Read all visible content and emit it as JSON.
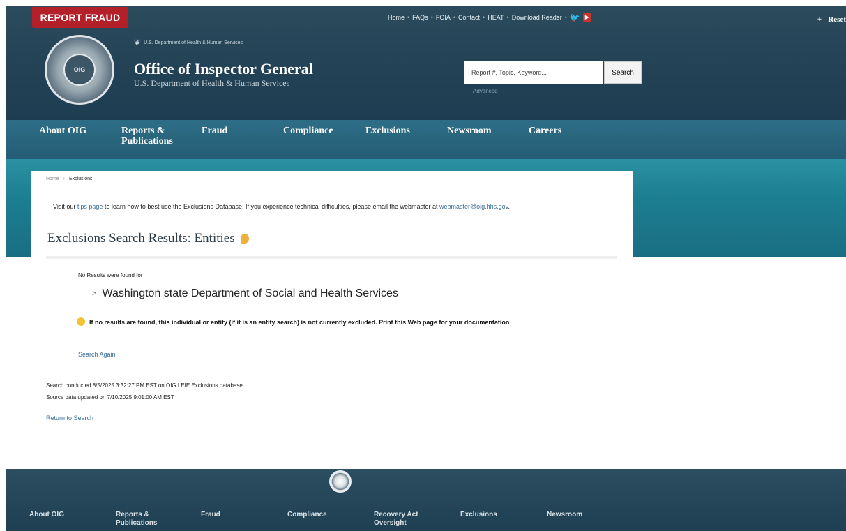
{
  "header": {
    "report_fraud": "REPORT FRAUD",
    "utility_links": [
      "Home",
      "FAQs",
      "FOIA",
      "Contact",
      "HEAT",
      "Download Reader"
    ],
    "resize_controls": "+ - Reset",
    "dept_small": "U.S. Department of Health & Human Services",
    "title": "Office of Inspector General",
    "subtitle": "U.S. Department of Health & Human Services",
    "seal_text": "OIG",
    "search": {
      "placeholder": "Report #, Topic, Keyword...",
      "button": "Search",
      "advanced": "Advanced"
    }
  },
  "nav": {
    "items": [
      {
        "label": "About OIG"
      },
      {
        "label": "Reports & Publications"
      },
      {
        "label": "Fraud"
      },
      {
        "label": "Compliance"
      },
      {
        "label": "Exclusions"
      },
      {
        "label": "Newsroom"
      },
      {
        "label": "Careers"
      }
    ]
  },
  "breadcrumb": {
    "home": "Home",
    "sep": "›",
    "current": "Exclusions"
  },
  "tip": {
    "before": "Visit our ",
    "link": "tips page",
    "middle": " to learn how to best use the Exclusions Database. If you experience technical difficulties, please email the webmaster at ",
    "email": "webmaster@oig.hhs.gov",
    "after": "."
  },
  "results": {
    "title": "Exclusions Search Results: Entities",
    "no_results": "No Results were found for",
    "query": "Washington state Department of Social and Health Services",
    "note": "If no results are found, this individual or entity (if it is an entity search) is not currently excluded. Print this Web page for your documentation",
    "search_again": "Search Again",
    "conducted": "Search conducted 8/5/2025 3:32:27 PM EST on OIG LEIE Exclusions database.",
    "updated": "Source data updated on 7/10/2025 9:01:00 AM EST",
    "return": "Return to Search"
  },
  "footer": {
    "items": [
      {
        "label": "About OIG"
      },
      {
        "label": "Reports & Publications"
      },
      {
        "label": "Fraud"
      },
      {
        "label": "Compliance"
      },
      {
        "label": "Recovery Act Oversight"
      },
      {
        "label": "Exclusions"
      },
      {
        "label": "Newsroom"
      }
    ]
  },
  "colors": {
    "report_fraud": "#b3202a",
    "header_bg": "#234255",
    "nav_bg": "#2d6e86",
    "band_bg": "#1d7e91",
    "link": "#3a6e9a"
  }
}
